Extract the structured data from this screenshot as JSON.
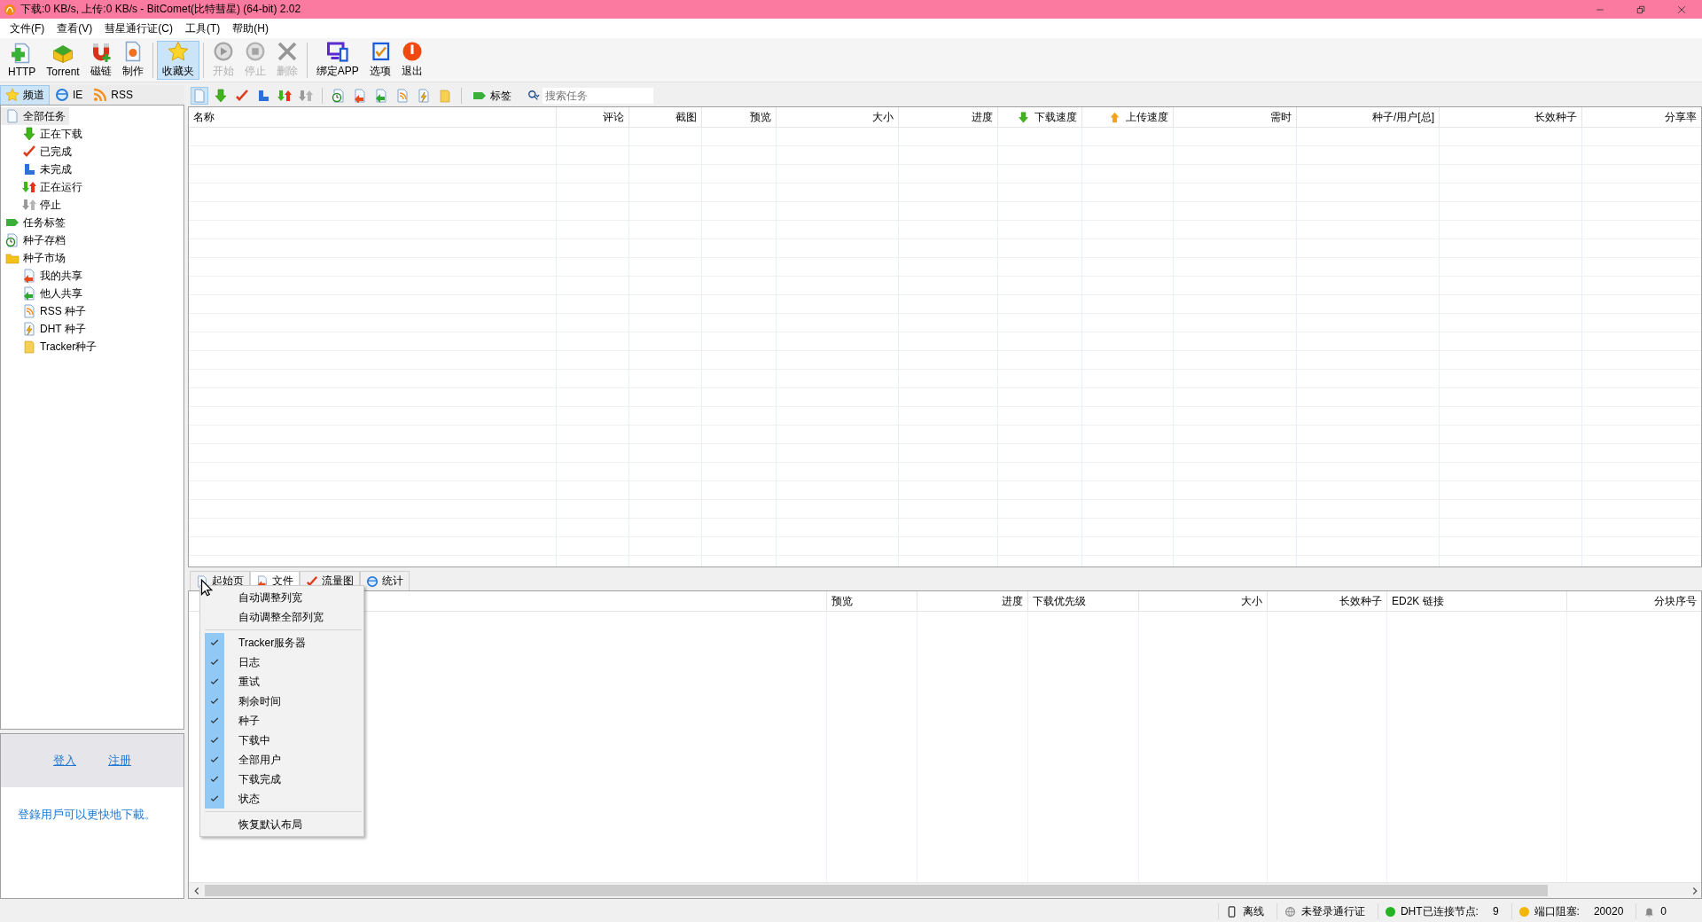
{
  "window": {
    "title": "下载:0 KB/s, 上传:0 KB/s - BitComet(比特彗星) (64-bit) 2.02"
  },
  "menu_bar": [
    "文件(F)",
    "查看(V)",
    "彗星通行证(C)",
    "工具(T)",
    "帮助(H)"
  ],
  "toolbar": [
    [
      {
        "label": "HTTP",
        "disabled": false,
        "selected": false
      },
      {
        "label": "Torrent",
        "disabled": false,
        "selected": false
      },
      {
        "label": "磁链",
        "disabled": false,
        "selected": false
      },
      {
        "label": "制作",
        "disabled": false,
        "selected": false
      }
    ],
    [
      {
        "label": "收藏夹",
        "disabled": false,
        "selected": true
      }
    ],
    [
      {
        "label": "开始",
        "disabled": true,
        "selected": false
      },
      {
        "label": "停止",
        "disabled": true,
        "selected": false
      },
      {
        "label": "删除",
        "disabled": true,
        "selected": false
      }
    ],
    [
      {
        "label": "绑定APP",
        "disabled": false,
        "selected": false
      },
      {
        "label": "选项",
        "disabled": false,
        "selected": false
      },
      {
        "label": "退出",
        "disabled": false,
        "selected": false
      }
    ]
  ],
  "sidebar": {
    "tabs": [
      {
        "label": "频道",
        "selected": true
      },
      {
        "label": "IE",
        "selected": false
      },
      {
        "label": "RSS",
        "selected": false
      }
    ],
    "tree": [
      {
        "label": "全部任务",
        "selected": true,
        "children": [
          {
            "label": "正在下载",
            "selected": false
          },
          {
            "label": "已完成",
            "selected": false
          },
          {
            "label": "未完成",
            "selected": false
          },
          {
            "label": "正在运行",
            "selected": false
          },
          {
            "label": "停止",
            "selected": false
          }
        ]
      },
      {
        "label": "任务标签",
        "selected": false
      },
      {
        "label": "种子存档",
        "selected": false
      },
      {
        "label": "种子市场",
        "selected": false,
        "children": [
          {
            "label": "我的共享",
            "selected": false
          },
          {
            "label": "他人共享",
            "selected": false
          },
          {
            "label": "RSS 种子",
            "selected": false
          },
          {
            "label": "DHT 种子",
            "selected": false
          },
          {
            "label": "Tracker种子",
            "selected": false
          }
        ]
      }
    ]
  },
  "login": {
    "links": [
      "登入",
      "注册"
    ],
    "message": "登錄用戶可以更快地下載。"
  },
  "task_toolbar": {
    "icon_buttons": [
      {
        "selected": true
      },
      {
        "selected": false
      },
      {
        "selected": false
      },
      {
        "selected": false
      },
      {
        "selected": false
      },
      {
        "selected": false
      },
      {
        "selected": false
      },
      {
        "selected": false
      },
      {
        "selected": false
      },
      {
        "selected": false
      },
      {
        "selected": false
      },
      {
        "selected": false
      }
    ],
    "tag_button": "标签",
    "search": {
      "placeholder": "搜索任务"
    }
  },
  "task_table": {
    "columns": [
      "名称",
      "评论",
      "截图",
      "预览",
      "大小",
      "进度",
      "下载速度",
      "上传速度",
      "需时",
      "种子/用户[总]",
      "长效种子",
      "分享率"
    ]
  },
  "detail_tabs": [
    {
      "label": "起始页",
      "selected": false
    },
    {
      "label": "文件",
      "selected": true
    },
    {
      "label": "流量图",
      "selected": false
    },
    {
      "label": "统计",
      "selected": false
    }
  ],
  "detail_table": {
    "columns": [
      "预览",
      "进度",
      "下载优先级",
      "大小",
      "长效种子",
      "ED2K 链接",
      "分块序号"
    ]
  },
  "context_menu": {
    "items": [
      {
        "kind": "action",
        "label": "自动调整列宽"
      },
      {
        "kind": "action",
        "label": "自动调整全部列宽"
      },
      {
        "kind": "separator"
      },
      {
        "kind": "check",
        "label": "Tracker服务器",
        "checked": true
      },
      {
        "kind": "check",
        "label": "日志",
        "checked": true
      },
      {
        "kind": "check",
        "label": "重试",
        "checked": true
      },
      {
        "kind": "check",
        "label": "剩余时间",
        "checked": true
      },
      {
        "kind": "check",
        "label": "种子",
        "checked": true
      },
      {
        "kind": "check",
        "label": "下载中",
        "checked": true
      },
      {
        "kind": "check",
        "label": "全部用户",
        "checked": true
      },
      {
        "kind": "check",
        "label": "下载完成",
        "checked": true
      },
      {
        "kind": "check",
        "label": "状态",
        "checked": true
      },
      {
        "kind": "separator"
      },
      {
        "kind": "action",
        "label": "恢复默认布局"
      }
    ]
  },
  "status_bar": {
    "connection": "离线",
    "passport": "未登录通行证",
    "indicators": [
      {
        "label": "DHT已连接节点:",
        "value": "9",
        "color": "#22b422"
      },
      {
        "label": "端口阻塞:",
        "value": "20020",
        "color": "#f2b705"
      }
    ],
    "alerts": "0"
  }
}
